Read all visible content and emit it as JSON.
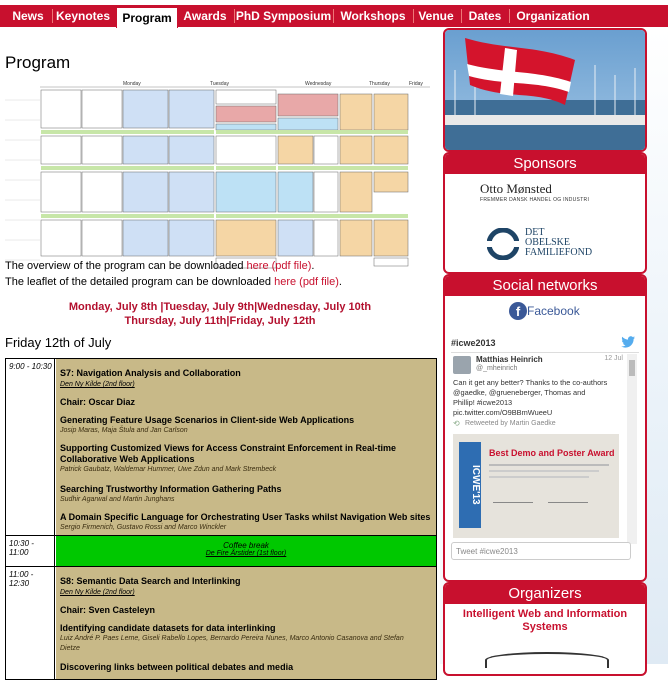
{
  "nav": {
    "items": [
      "News",
      "Keynotes",
      "Program",
      "Awards",
      "PhD Symposium",
      "Workshops",
      "Venue",
      "Dates",
      "Organization"
    ],
    "active_index": 2
  },
  "main": {
    "title": "Program",
    "overview_pre": "The overview of the program can be downloaded ",
    "overview_link": "here (pdf file)",
    "overview_post": ".",
    "leaflet_pre": "The leaflet of the detailed program can be downloaded ",
    "leaflet_link": "here (pdf file)",
    "leaflet_post": ".",
    "day_links_line1": [
      "Monday, July 8th",
      "Tuesday, July 9th",
      "Wednesday, July 10th"
    ],
    "day_links_line2": [
      "Thursday, July 11th",
      "Friday, July 12th"
    ],
    "day_section_title": "Friday 12th of July",
    "schedule_headers": [
      "Monday",
      "Tuesday",
      "Wednesday",
      "Thursday",
      "Friday"
    ]
  },
  "program": {
    "slot1": {
      "time": "9:00 - 10:30",
      "session": "S7: Navigation Analysis and Collaboration",
      "room": "Den Ny Kilde (2nd floor)",
      "chair": "Chair: Oscar Diaz",
      "papers": [
        {
          "title": "Generating Feature Usage Scenarios in Client-side Web Applications",
          "authors": "Josip Maras, Maja Štula and Jan Carlson"
        },
        {
          "title": "Supporting Customized Views for Access Constraint Enforcement in Real-time",
          "title2": "Collaborative Web Applications",
          "authors": "Patrick Gaubatz, Waldemar Hummer, Uwe Zdun and Mark Strembeck"
        },
        {
          "title": "Searching Trustworthy Information Gathering Paths",
          "authors": "Sudhir Agarwal and Martin Junghans"
        },
        {
          "title": "A Domain Specific Language for Orchestrating User Tasks whilst Navigation Web sites",
          "authors": "Sergio Firmenich, Gustavo Rossi and Marco Winckler"
        }
      ]
    },
    "break": {
      "time": "10:30 - 11:00",
      "label": "Coffee break",
      "room": "De Fire Årstider (1st floor)"
    },
    "slot2": {
      "time": "11:00 - 12:30",
      "session": "S8: Semantic Data Search and Interlinking",
      "room": "Den Ny Kilde (2nd floor)",
      "chair": "Chair: Sven Casteleyn",
      "papers": [
        {
          "title": "Identifying candidate datasets for data interlinking",
          "authors": "Luiz André P. Paes Leme, Giseli Rabello Lopes, Bernardo Pereira Nunes, Marco Antonio Casanova and Stefan",
          "authors2": "Dietze"
        },
        {
          "title": "Discovering links between political debates and media"
        }
      ]
    }
  },
  "sidebar": {
    "sponsors_title": "Sponsors",
    "sponsor1_name": "Otto Mønsted",
    "sponsor1_sub": "FREMMER DANSK HANDEL OG INDUSTRI",
    "sponsor2_line1": "DET",
    "sponsor2_line2": "OBELSKE",
    "sponsor2_line3": "FAMILIEFOND",
    "social_title": "Social networks",
    "facebook_label": "Facebook",
    "twitter": {
      "hashtag": "#icwe2013",
      "user_name": "Matthias Heinrich",
      "user_handle": "@_mheinrich",
      "date": "12 Jul",
      "tweet_line1": "Can it get any better?  Thanks to the co-authors",
      "tweet_line2": "@gaedke, @grueneberger, Thomas and",
      "tweet_line3": "Phillip! #icwe2013",
      "tweet_line4": "pic.twitter.com/O9BBmWueeU",
      "retweet": "Retweeted by Martin Gaedke",
      "award_title": "Best Demo and Poster Award",
      "award_logo": "ICWE'13",
      "compose_placeholder": "Tweet #icwe2013"
    },
    "organizers_title": "Organizers",
    "organizers_text": "Intelligent Web and Information Systems"
  },
  "colors": {
    "brand_red": "#c8102e",
    "session_bg": "#c8b988",
    "break_green": "#00c800"
  }
}
